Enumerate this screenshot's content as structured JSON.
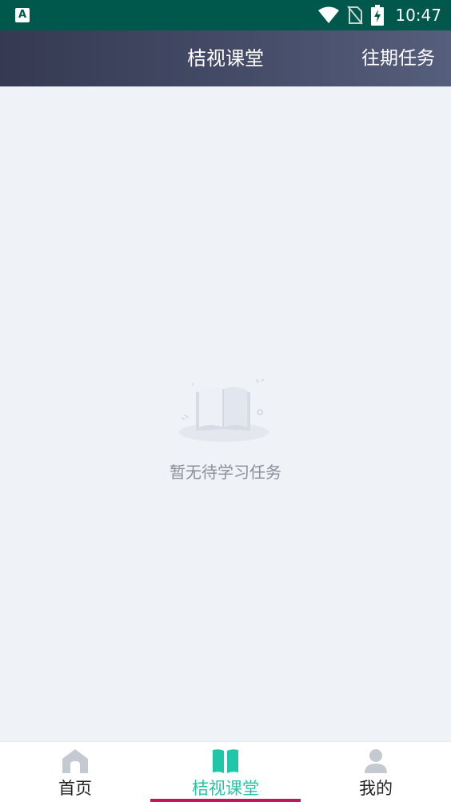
{
  "status_bar": {
    "app_badge": "A",
    "time": "10:47"
  },
  "header": {
    "title": "桔视课堂",
    "history_button": "往期任务"
  },
  "empty_state": {
    "message": "暂无待学习任务",
    "icon": "open-book-icon"
  },
  "tabs": [
    {
      "label": "首页",
      "icon": "home-icon",
      "active": false
    },
    {
      "label": "桔视课堂",
      "icon": "book-icon",
      "active": true
    },
    {
      "label": "我的",
      "icon": "person-icon",
      "active": false
    }
  ],
  "colors": {
    "status_bar": "#00574b",
    "accent": "#1fc7a8",
    "indicator": "#c2185b",
    "background": "#eff2f7"
  }
}
